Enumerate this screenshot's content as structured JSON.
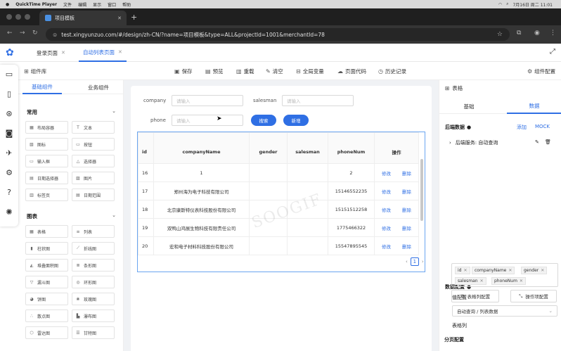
{
  "mac_menu": {
    "app": "QuickTime Player",
    "items": [
      "文件",
      "编辑",
      "显示",
      "窗口",
      "帮助"
    ],
    "clock": "7月16日 周二 11:01"
  },
  "browser": {
    "tab_title": "项目模板",
    "url": "test.xingyunzuo.com/#/design/zh-CN/?name=项目模板&type=ALL&projectId=1001&merchantId=78"
  },
  "app": {
    "page_tabs": [
      "登录页面",
      "自动列表页面"
    ],
    "toolbar": {
      "library": "组件库",
      "save": "保存",
      "preview": "预览",
      "reload": "重载",
      "clear": "清空",
      "global_vars": "全局变量",
      "page_code": "页面代码",
      "history": "历史记录",
      "component_config": "组件配置"
    },
    "left": {
      "tabs": [
        "基础组件",
        "业务组件"
      ],
      "section1": "常用",
      "common": [
        "布局容器",
        "文本",
        "图标",
        "按钮",
        "输入框",
        "选择器",
        "日期选择器",
        "图片",
        "标签页",
        "日期范围"
      ],
      "section2": "图表",
      "charts": [
        "表格",
        "列表",
        "柱状图",
        "折线图",
        "堆叠面积图",
        "条形图",
        "漏斗图",
        "环形图",
        "饼图",
        "玫瑰图",
        "散点图",
        "瀑布图",
        "雷达图",
        "甘特图"
      ]
    },
    "form": {
      "company_label": "company",
      "company_placeholder": "请输入",
      "salesman_label": "salesman",
      "salesman_placeholder": "请输入",
      "phone_label": "phone",
      "phone_placeholder": "请输入",
      "search_btn": "搜索",
      "add_btn": "新增"
    },
    "table": {
      "headers": [
        "id",
        "companyName",
        "gender",
        "salesman",
        "phoneNum",
        "操作"
      ],
      "rows": [
        {
          "id": "16",
          "company": "1",
          "gender": "",
          "salesman": "",
          "phone": "2"
        },
        {
          "id": "17",
          "company": "郑州海为电子科技有限公司",
          "gender": "",
          "salesman": "",
          "phone": "15146552235"
        },
        {
          "id": "18",
          "company": "北京康斯特仪表科技股份有限公司",
          "gender": "",
          "salesman": "",
          "phone": "15151512258"
        },
        {
          "id": "19",
          "company": "双鸭山鸿展生物科技有限责任公司",
          "gender": "",
          "salesman": "",
          "phone": "1775466322"
        },
        {
          "id": "20",
          "company": "宏和电子材料科技股份有限公司",
          "gender": "",
          "salesman": "",
          "phone": "15547895545"
        }
      ],
      "edit": "修改",
      "delete": "删除",
      "page": "1"
    },
    "watermark": "SOOGIF",
    "right": {
      "title": "表格",
      "tabs": [
        "基础",
        "数据"
      ],
      "backend_data": "后端数据",
      "add": "添加",
      "mock": "MOCK",
      "service": "后端服务: 自动查询",
      "data_config": "数据配置",
      "value_config": "值配置",
      "value_select": "自动查询 / 列表数据",
      "columns_label": "表格列",
      "columns": [
        "id",
        "companyName",
        "gender",
        "salesman",
        "phoneNum"
      ],
      "col_config_btn": "表格列配置",
      "op_config_btn": "操作项配置",
      "pager_config": "分页配置"
    }
  }
}
